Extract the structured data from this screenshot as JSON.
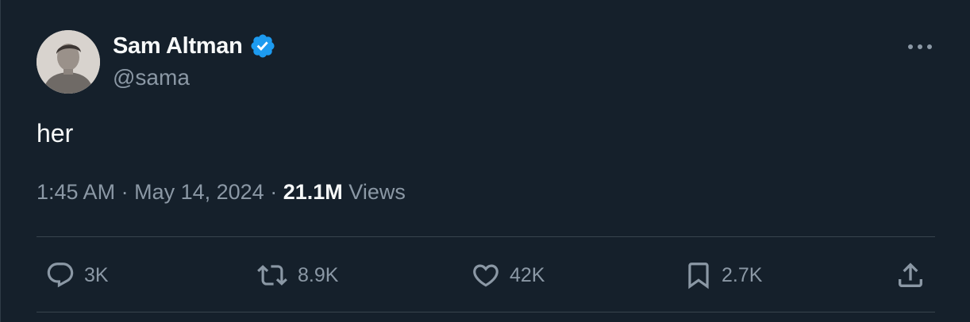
{
  "user": {
    "display_name": "Sam Altman",
    "handle": "@sama",
    "verified": true,
    "avatar_icon": "profile-photo"
  },
  "tweet": {
    "text": "her",
    "time": "1:45 AM",
    "separator": "·",
    "date": "May 14, 2024",
    "views_count": "21.1M",
    "views_label": "Views"
  },
  "actions": {
    "reply": {
      "icon": "reply-icon",
      "count": "3K"
    },
    "retweet": {
      "icon": "retweet-icon",
      "count": "8.9K"
    },
    "like": {
      "icon": "heart-icon",
      "count": "42K"
    },
    "bookmark": {
      "icon": "bookmark-icon",
      "count": "2.7K"
    },
    "share": {
      "icon": "share-icon"
    }
  },
  "colors": {
    "background": "#15202b",
    "text_primary": "#f7f9f9",
    "text_secondary": "#8b98a5",
    "verified_badge": "#1d9bf0",
    "divider": "#38444d"
  }
}
